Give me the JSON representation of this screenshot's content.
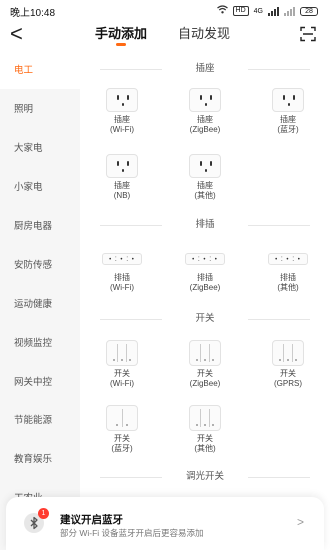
{
  "status": {
    "time": "晚上10:48",
    "battery": "28",
    "hd": "HD",
    "net": "4G"
  },
  "nav": {
    "back": "<",
    "tabs": [
      "手动添加",
      "自动发现"
    ],
    "active_tab": 0,
    "accent": "#ff6a13"
  },
  "sidebar": {
    "items": [
      "电工",
      "照明",
      "大家电",
      "小家电",
      "厨房电器",
      "安防传感",
      "运动健康",
      "视频监控",
      "网关中控",
      "节能能源",
      "教育娱乐",
      "工农业"
    ],
    "active": 0
  },
  "sections": [
    {
      "title": "插座",
      "devices": [
        {
          "name": "插座",
          "proto": "(Wi-Fi)"
        },
        {
          "name": "插座",
          "proto": "(ZigBee)"
        },
        {
          "name": "插座",
          "proto": "(蓝牙)"
        },
        {
          "name": "插座",
          "proto": "(NB)"
        },
        {
          "name": "插座",
          "proto": "(其他)"
        }
      ]
    },
    {
      "title": "排插",
      "devices": [
        {
          "name": "排插",
          "proto": "(Wi-Fi)"
        },
        {
          "name": "排插",
          "proto": "(ZigBee)"
        },
        {
          "name": "排插",
          "proto": "(其他)"
        }
      ]
    },
    {
      "title": "开关",
      "devices": [
        {
          "name": "开关",
          "proto": "(Wi-Fi)"
        },
        {
          "name": "开关",
          "proto": "(ZigBee)"
        },
        {
          "name": "开关",
          "proto": "(GPRS)"
        },
        {
          "name": "开关",
          "proto": "(蓝牙)"
        },
        {
          "name": "开关",
          "proto": "(其他)"
        }
      ]
    },
    {
      "title": "调光开关",
      "devices": []
    }
  ],
  "banner": {
    "title": "建议开启蓝牙",
    "subtitle": "部分 Wi-Fi 设备蓝牙开启后更容易添加",
    "badge": "1",
    "chevron": ">"
  }
}
